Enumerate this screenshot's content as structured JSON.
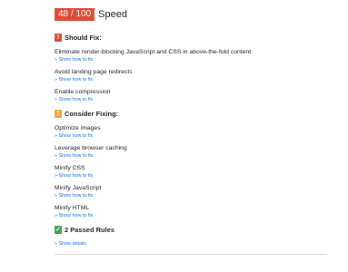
{
  "score": {
    "value": "48 / 100",
    "label": "Speed",
    "color": "#dd4b39"
  },
  "should_fix": {
    "icon": "exclamation-icon",
    "title": "Should Fix:",
    "rules": [
      {
        "title": "Eliminate render-blocking JavaScript and CSS in above-the-fold content",
        "link": "» Show how to fix"
      },
      {
        "title": "Avoid landing page redirects",
        "link": "» Show how to fix"
      },
      {
        "title": "Enable compression",
        "link": "» Show how to fix"
      }
    ]
  },
  "consider_fixing": {
    "icon": "exclamation-icon",
    "title": "Consider Fixing:",
    "rules": [
      {
        "title": "Optimize images",
        "link": "» Show how to fix"
      },
      {
        "title": "Leverage browser caching",
        "link": "» Show how to fix"
      },
      {
        "title": "Minify CSS",
        "link": "» Show how to fix"
      },
      {
        "title": "Minify JavaScript",
        "link": "» Show how to fix"
      },
      {
        "title": "Minify HTML",
        "link": "» Show how to fix"
      }
    ]
  },
  "passed": {
    "icon": "checkmark-icon",
    "title": "2 Passed Rules",
    "link": "» Show details"
  },
  "colors": {
    "red": "#dd4b39",
    "orange": "#f2a93b",
    "green": "#3aa757",
    "link": "#1a73e8"
  }
}
